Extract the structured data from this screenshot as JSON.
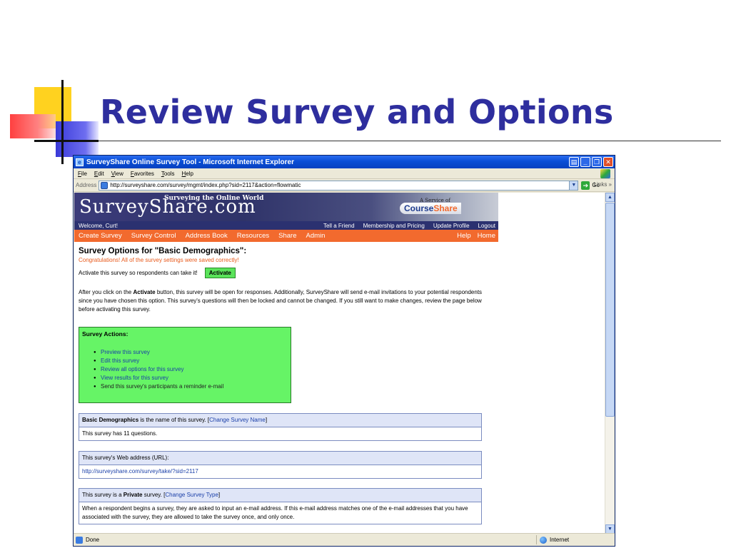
{
  "slide": {
    "title": "Review Survey and Options"
  },
  "window": {
    "title": "SurveyShare Online Survey Tool - Microsoft Internet Explorer",
    "menus": [
      "File",
      "Edit",
      "View",
      "Favorites",
      "Tools",
      "Help"
    ],
    "address_label": "Address",
    "address_url": "http://surveyshare.com/survey/mgmt/index.php?sid=2117&action=flowmatic",
    "go_label": "Go",
    "links_label": "Links",
    "status_text": "Done",
    "status_zone": "Internet"
  },
  "site": {
    "logo": "SurveyShare.com",
    "tagline": "Surveying the Online World",
    "service_of": "A Service of",
    "courseshare_course": "Course",
    "courseshare_share": "Share",
    "welcome": "Welcome, Curt!",
    "top_links": [
      "Tell a Friend",
      "Membership and Pricing",
      "Update Profile",
      "Logout"
    ],
    "nav_items": [
      "Create Survey",
      "Survey Control",
      "Address Book",
      "Resources",
      "Share",
      "Admin"
    ],
    "nav_right": [
      "Help",
      "Home"
    ]
  },
  "page": {
    "heading": "Survey Options for \"Basic Demographics\":",
    "congrats": "Congratulations! All of the survey settings were saved correctly!",
    "activate_prompt": "Activate this survey so respondents can take it!",
    "activate_button": "Activate",
    "para_pre": "After you click on the ",
    "para_bold": "Activate",
    "para_post": " button, this survey will be open for responses. Additionally, SurveyShare will send e-mail invitations to your potential respondents since you have chosen this option. This survey's questions will then be locked and cannot be changed. If you still want to make changes, review the page below before activating this survey.",
    "actions_title": "Survey Actions:",
    "actions": [
      "Preview this survey",
      "Edit this survey",
      "Review all options for this survey",
      "View results for this survey",
      "Send this survey's participants a reminder e-mail"
    ],
    "name_box": {
      "name_bold": "Basic Demographics",
      "name_suffix": " is the name of this survey.  [",
      "change_link": "Change Survey Name",
      "close_bracket": "]",
      "questions": "This survey has 11 questions."
    },
    "url_box": {
      "label": "This survey's Web address (URL):",
      "url": "http://surveyshare.com/survey/take/?sid=2117"
    },
    "type_box": {
      "prefix": "This survey is a ",
      "type_bold": "Private",
      "suffix": " survey.   [",
      "change_link": "Change Survey Type",
      "close_bracket": "]",
      "description": "When a respondent begins a survey, they are asked to input an e-mail address. If this e-mail address matches one of the e-mail addresses that you have associated with the survey, they are allowed to take the survey once, and only once."
    }
  }
}
